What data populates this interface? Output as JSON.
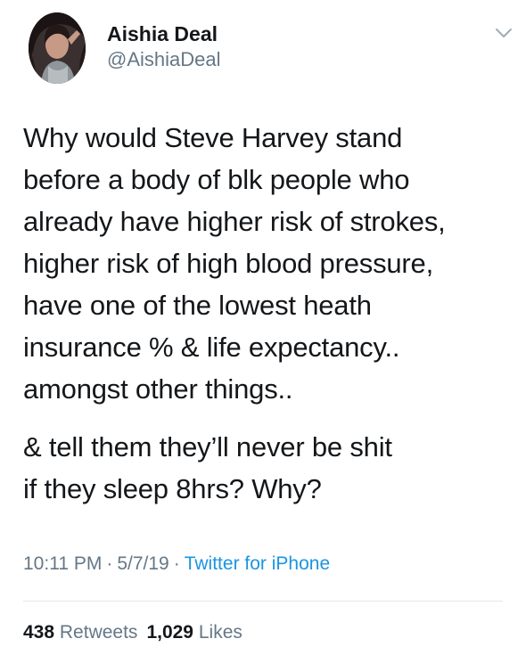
{
  "user": {
    "display_name": "Aishia Deal",
    "handle": "@AishiaDeal"
  },
  "tweet": {
    "paragraphs": [
      [
        "Why would Steve Harvey stand",
        "before a body of blk people who",
        "already have higher risk of strokes,",
        "higher risk of high blood pressure,",
        "have one of the lowest heath",
        "insurance % & life expectancy..",
        "amongst other things.."
      ],
      [
        "& tell them they’ll never be shit",
        "if they sleep 8hrs? Why?"
      ]
    ]
  },
  "meta": {
    "time": "10:11 PM",
    "separator": "·",
    "date": "5/7/19",
    "source": "Twitter for iPhone"
  },
  "stats": {
    "retweets_count": "438",
    "retweets_label": "Retweets",
    "likes_count": "1,029",
    "likes_label": "Likes"
  },
  "icons": {
    "menu": "chevron-down-icon"
  },
  "colors": {
    "text": "#14171a",
    "secondary": "#657786",
    "link": "#1b95e0",
    "divider": "#e1e8ed"
  }
}
